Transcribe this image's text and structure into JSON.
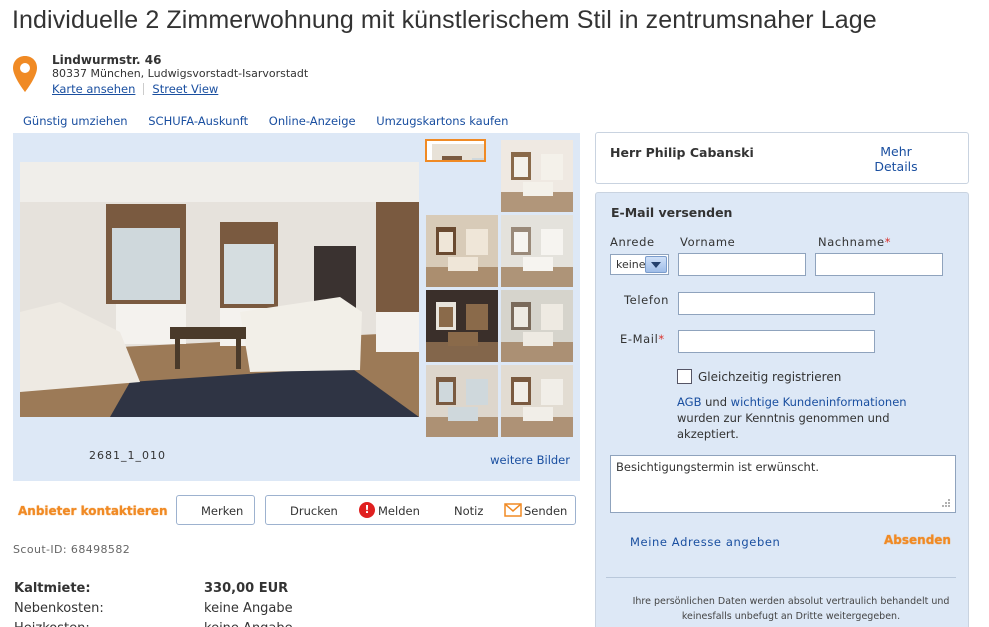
{
  "listing": {
    "title": "Individuelle 2 Zimmerwohnung mit künstlerischem Stil in zentrumsnaher Lage",
    "street": "Lindwurmstr. 46",
    "city": "80337 München, Ludwigsvorstadt-Isarvorstadt",
    "map_link": "Karte ansehen",
    "street_view_link": "Street View"
  },
  "topnav": [
    "Günstig umziehen",
    "SCHUFA-Auskunft",
    "Online-Anzeige",
    "Umzugskartons kaufen"
  ],
  "gallery": {
    "caption": "2681_1_010",
    "more_link": "weitere Bilder",
    "thumbnail_count": 8,
    "selected_thumbnail": 1
  },
  "actions": {
    "contact": "Anbieter kontaktieren",
    "remember": "Merken",
    "print": "Drucken",
    "report": "Melden",
    "note": "Notiz",
    "send": "Senden"
  },
  "scout_id": "Scout-ID: 68498582",
  "costs": [
    {
      "label": "Kaltmiete:",
      "value": "330,00 EUR"
    },
    {
      "label": "Nebenkosten:",
      "value": "keine Angabe"
    },
    {
      "label": "Heizkosten:",
      "value": "keine Angabe"
    }
  ],
  "agent": {
    "name": "Herr Philip Cabanski",
    "more_details": "Mehr Details"
  },
  "form": {
    "title": "E-Mail versenden",
    "salutation_label": "Anrede",
    "salutation_value": "keine",
    "firstname_label": "Vorname",
    "lastname_label": "Nachname",
    "phone_label": "Telefon",
    "email_label": "E-Mail",
    "required_mark": "*",
    "register_label": "Gleichzeitig registrieren",
    "agb_link": "AGB",
    "agb_and": "und",
    "customer_info_link": "wichtige Kundeninformationen",
    "agb_rest": "wurden zur Kenntnis genommen und akzeptiert.",
    "message": "Besichtigungstermin ist erwünscht.",
    "address_link": "Meine Adresse angeben",
    "submit": "Absenden",
    "privacy": "Ihre persönlichen Daten werden absolut vertraulich behandelt und keinesfalls unbefugt an Dritte weitergegeben."
  },
  "colors": {
    "accent": "#f08a24",
    "link": "#1a4fa0",
    "panel": "#dde8f6",
    "required": "#d9302a"
  }
}
